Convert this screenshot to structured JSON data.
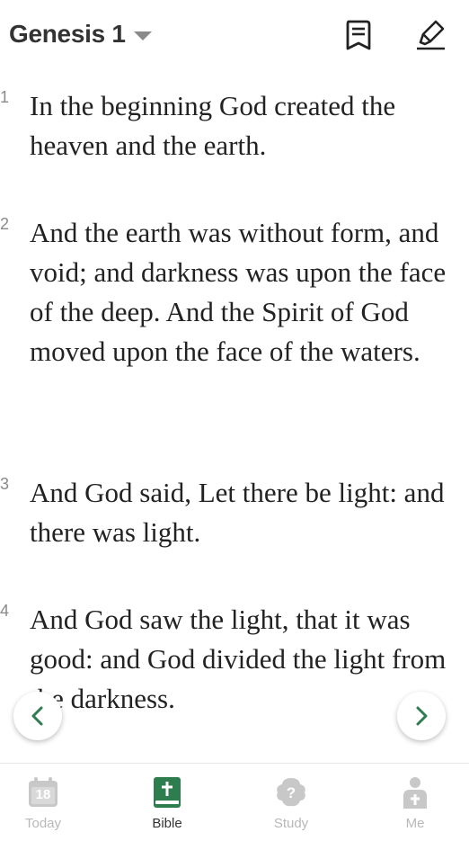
{
  "header": {
    "book_title": "Genesis 1"
  },
  "verses": [
    {
      "number": "1",
      "text": "In the beginning God created the heaven and the earth."
    },
    {
      "number": "2",
      "text": "And the earth was without form, and void; and darkness was upon the face of the deep. And the Spirit of God moved upon the face of the waters."
    },
    {
      "number": "3",
      "text": "And God said, Let there be light: and there was light."
    },
    {
      "number": "4",
      "text": "And God saw the light, that it was good: and God divided the light from the darkness."
    }
  ],
  "tabbar": {
    "today_date": "18",
    "tabs": [
      {
        "label": "Today",
        "icon": "calendar-icon",
        "active": false
      },
      {
        "label": "Bible",
        "icon": "bible-icon",
        "active": true
      },
      {
        "label": "Study",
        "icon": "study-icon",
        "active": false
      },
      {
        "label": "Me",
        "icon": "person-icon",
        "active": false
      }
    ]
  },
  "colors": {
    "accent": "#2e7d4f",
    "nav_arrow": "#2e7d4f",
    "inactive": "#c8c8c8",
    "verse_number": "#8a8a8a"
  }
}
